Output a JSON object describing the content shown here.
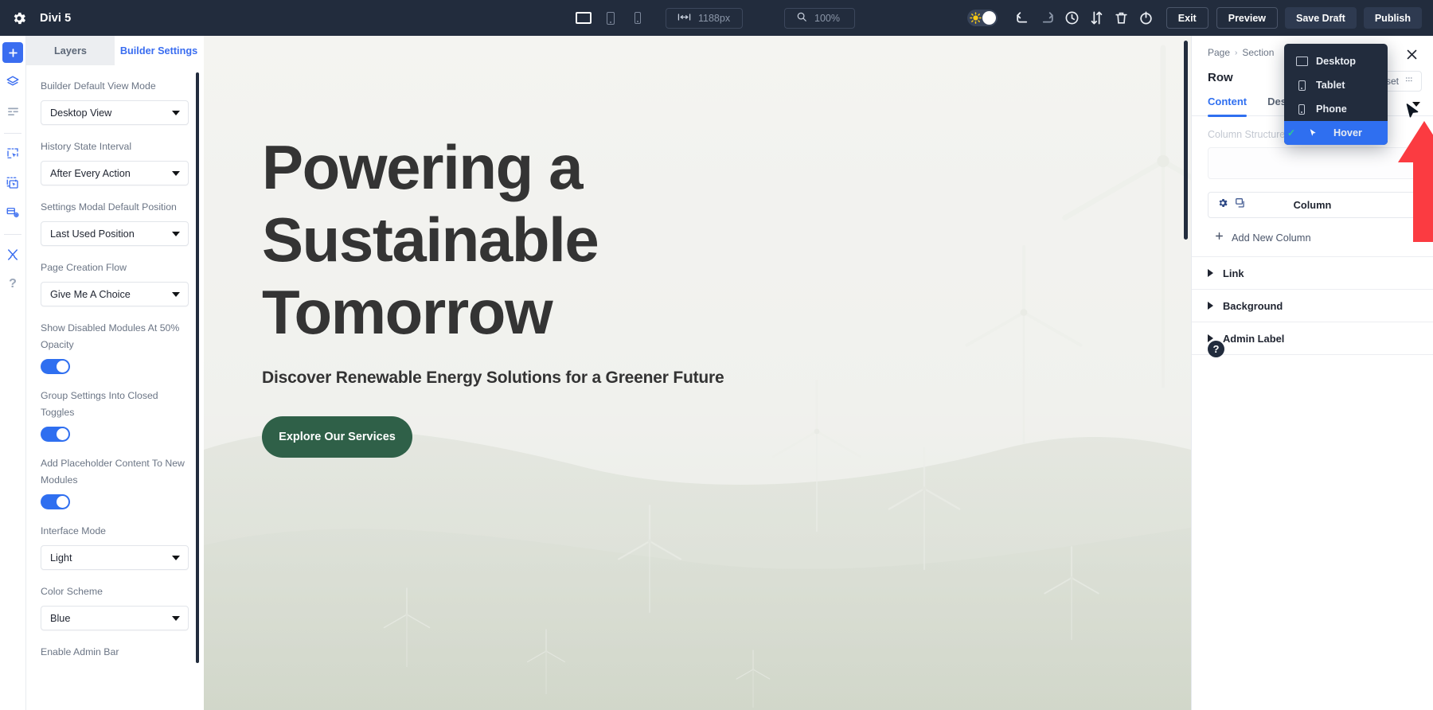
{
  "topbar": {
    "app_title": "Divi 5",
    "gear_icon": "gear-icon",
    "viewports": [
      {
        "name": "desktop",
        "icon": "desktop-icon",
        "active": true
      },
      {
        "name": "tablet",
        "icon": "tablet-icon",
        "active": false
      },
      {
        "name": "phone",
        "icon": "phone-icon",
        "active": false
      }
    ],
    "width_value": "1188px",
    "width_icon": "resize-horizontal-icon",
    "zoom_value": "100%",
    "zoom_icon": "magnifier-icon",
    "theme_toggle": {
      "name": "light-dark-toggle",
      "icon": "sun-icon",
      "state": "on"
    },
    "icons": [
      {
        "name": "undo-icon",
        "glyph": "undo"
      },
      {
        "name": "redo-icon",
        "glyph": "redo"
      },
      {
        "name": "history-clock-icon",
        "glyph": "clock"
      },
      {
        "name": "portability-icon",
        "glyph": "arrows-up-down"
      },
      {
        "name": "trash-icon",
        "glyph": "trash"
      },
      {
        "name": "power-icon",
        "glyph": "power"
      }
    ],
    "exit_label": "Exit",
    "preview_label": "Preview",
    "save_draft_label": "Save Draft",
    "publish_label": "Publish",
    "accent": "#2f6ff0",
    "bar_bg": "#222c3d"
  },
  "rail": {
    "items": [
      {
        "name": "add-module",
        "icon": "plus-icon",
        "active": true
      },
      {
        "name": "layers",
        "icon": "layers-icon",
        "active": false
      },
      {
        "name": "wireframe",
        "icon": "wireframe-icon",
        "active": false
      },
      {
        "name": "select-single",
        "icon": "select-module-icon",
        "active": false
      },
      {
        "name": "select-multi",
        "icon": "multiselect-icon",
        "active": false
      },
      {
        "name": "responsive-preview",
        "icon": "responsive-view-icon",
        "active": false
      },
      {
        "name": "tools",
        "icon": "wrench-screwdriver-icon",
        "active": false
      },
      {
        "name": "help",
        "icon": "question-mark-icon",
        "active": false
      }
    ]
  },
  "left_panel": {
    "tabs": [
      {
        "label": "Layers",
        "active": false
      },
      {
        "label": "Builder Settings",
        "active": true
      }
    ],
    "fields": [
      {
        "type": "select",
        "label": "Builder Default View Mode",
        "value": "Desktop View"
      },
      {
        "type": "select",
        "label": "History State Interval",
        "value": "After Every Action"
      },
      {
        "type": "select",
        "label": "Settings Modal Default Position",
        "value": "Last Used Position"
      },
      {
        "type": "select",
        "label": "Page Creation Flow",
        "value": "Give Me A Choice"
      },
      {
        "type": "toggle",
        "label": "Show Disabled Modules At 50% Opacity",
        "value": "on"
      },
      {
        "type": "toggle",
        "label": "Group Settings Into Closed Toggles",
        "value": "on"
      },
      {
        "type": "toggle",
        "label": "Add Placeholder Content To New Modules",
        "value": "on"
      },
      {
        "type": "select",
        "label": "Interface Mode",
        "value": "Light"
      },
      {
        "type": "select",
        "label": "Color Scheme",
        "value": "Blue"
      },
      {
        "type": "label-only",
        "label": "Enable Admin Bar",
        "value": ""
      }
    ]
  },
  "canvas": {
    "hero_title": "Powering a Sustainable Tomorrow",
    "hero_subtitle": "Discover Renewable Energy Solutions for a Greener Future",
    "cta_label": "Explore Our Services",
    "cta_color": "#2f6048",
    "bg_description": "wind-turbine-field-photo"
  },
  "right_panel": {
    "breadcrumb": [
      "Page",
      "Section"
    ],
    "title": "Row",
    "close_icon": "close-icon",
    "reset_label": "Reset",
    "reset_icon": "reset-icon",
    "tabs": [
      {
        "label": "Content",
        "active": true
      },
      {
        "label": "Design",
        "active": false
      }
    ],
    "tab_caret_icon": "chevron-down-icon",
    "column_structure_label": "Column Structure",
    "column_row_label": "Column",
    "column_row_icons": [
      "gear-icon",
      "duplicate-icon"
    ],
    "add_column_label": "Add New Column",
    "add_column_icon": "plus-icon",
    "toggles": [
      {
        "label": "Link",
        "icon": "triangle-right-icon"
      },
      {
        "label": "Background",
        "icon": "triangle-right-icon"
      },
      {
        "label": "Admin Label",
        "icon": "triangle-right-icon"
      }
    ],
    "help_icon": "question-circle-icon"
  },
  "dropdown": {
    "items": [
      {
        "label": "Desktop",
        "icon": "desktop-icon",
        "selected": false
      },
      {
        "label": "Tablet",
        "icon": "tablet-icon",
        "selected": false
      },
      {
        "label": "Phone",
        "icon": "phone-icon",
        "selected": false
      },
      {
        "label": "Hover",
        "icon": "cursor-icon",
        "selected": true
      }
    ],
    "bg": "#222c3d",
    "selected_bg": "#2f6ff0",
    "check_color": "#2ecc8f"
  },
  "annotation": {
    "arrow_color": "#fb3b41",
    "arrow_name": "red-callout-arrow",
    "cursor_name": "mouse-pointer"
  }
}
